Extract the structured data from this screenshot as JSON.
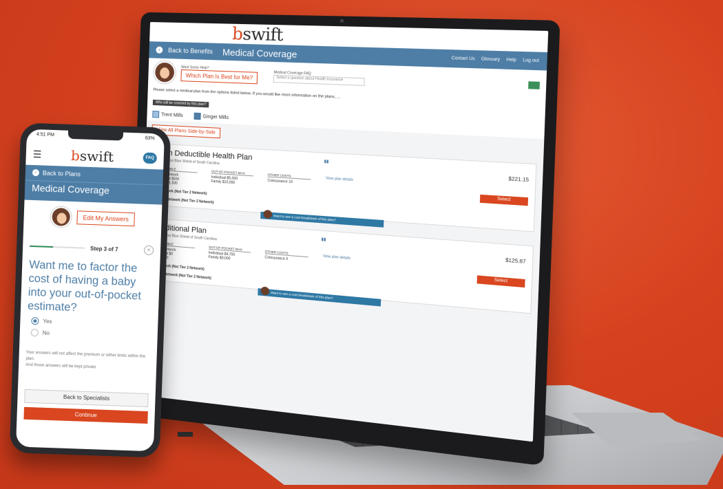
{
  "laptop": {
    "logo": "bswift",
    "back_label": "Back to Benefits",
    "title": "Medical Coverage",
    "utility": [
      "Contact Us",
      "Glossary",
      "Help",
      "Log out"
    ],
    "help_prompt": "Want Some Help?",
    "which_plan_button": "Which Plan Is Best for Me?",
    "faq_label": "Medical Coverage FAQ",
    "faq_placeholder": "Select a question about Health Insurance",
    "instructions": "Please select a medical plan from the options listed below. If you would like more information on the plans, ...",
    "covered_tag": "Who will be covered by this plan?",
    "members": [
      "Trent Mills",
      "Ginger Mills"
    ],
    "view_all": "View All Plans Side-by-Side",
    "plans": [
      {
        "name": "High Deductible Health Plan",
        "carrier": "Blue Cross Blue Shield of South Carolina",
        "col1_head": "DEDUCTIBLE",
        "col2_head": "OUT-OF-POCKET MAX",
        "col3_head": "OTHER COSTS",
        "tier": "Tier 1 Network",
        "ded_ind": "Individual $500",
        "ded_fam": "Family $1,500",
        "oop_ind": "Individual $5,000",
        "oop_fam": "Family $10,000",
        "other": "Coinsurance 10",
        "view_details": "View plan details",
        "cost": "$221.15",
        "select": "Select",
        "in_network2": "In-Network (Not Tier 2 Network)",
        "out_network": "Out-of-Network (Not Tier 2 Network)",
        "ribbon": "Want to see a cost breakdown of this plan?"
      },
      {
        "name": "Traditional Plan",
        "carrier": "Blue Cross Blue Shield of South Carolina",
        "col1_head": "DEDUCTIBLE",
        "col2_head": "OUT-OF-POCKET MAX",
        "col3_head": "OTHER COSTS",
        "tier": "Tier 1 Network",
        "ded_ind": "Individual $0",
        "ded_fam": "Family $0",
        "oop_ind": "Individual $4,700",
        "oop_fam": "Family $9,000",
        "other": "Coinsurance 0",
        "view_details": "View plan details",
        "cost": "$125.87",
        "select": "Select",
        "in_network2": "In-Network (Not Tier 2 Network)",
        "out_network": "Out-of-Network (Not Tier 2 Network)",
        "ribbon": "Want to see a cost breakdown of this plan?"
      }
    ]
  },
  "phone": {
    "time": "4:51 PM",
    "battery": "63%",
    "logo": "bswift",
    "faq": "FAQ",
    "back_label": "Back to Plans",
    "title": "Medical Coverage",
    "edit_button": "Edit My Answers",
    "step": "Step 3 of 7",
    "progress": 0.43,
    "question": "Want me to factor the cost of having a baby into your out-of-pocket estimate?",
    "options": [
      "Yes",
      "No"
    ],
    "selected_option": "Yes",
    "disclaimer_1": "Your answers will not affect the premium or either limits within the plan.",
    "disclaimer_2": "And those answers will be kept private.",
    "back_button": "Back to Specialists",
    "continue_button": "Continue"
  },
  "colors": {
    "brand_orange": "#d9461f",
    "brand_blue": "#4e7ea6",
    "background": "#d6421f"
  }
}
